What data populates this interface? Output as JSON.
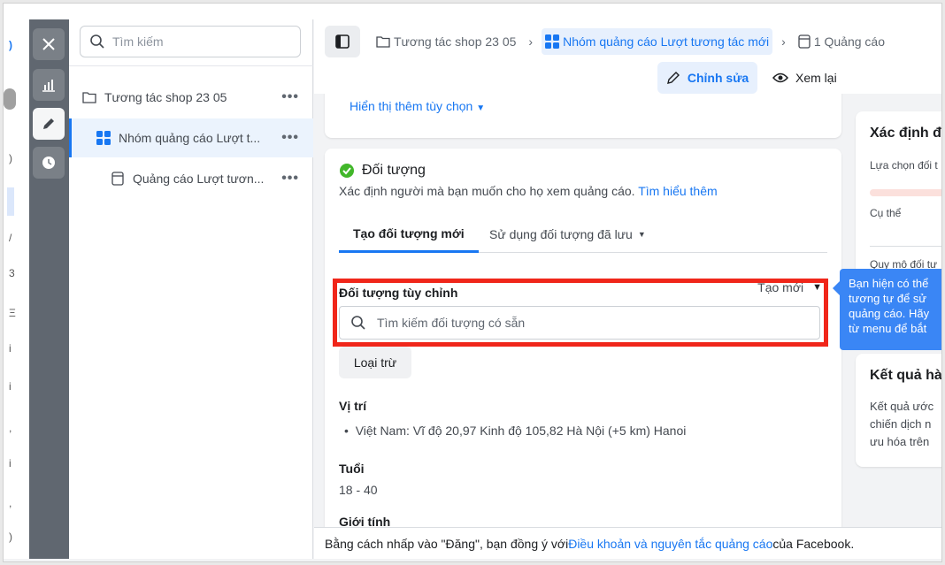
{
  "tree": {
    "search_placeholder": "Tìm kiếm",
    "items": [
      {
        "label": "Tương tác shop 23 05"
      },
      {
        "label": "Nhóm quảng cáo Lượt t..."
      },
      {
        "label": "Quảng cáo Lượt tươn..."
      }
    ],
    "dots": "•••"
  },
  "header": {
    "breadcrumbs": [
      {
        "label": "Tương tác shop 23 05"
      },
      {
        "label": "Nhóm quảng cáo Lượt tương tác mới"
      },
      {
        "label": "1 Quảng cáo"
      }
    ],
    "edit_label": "Chỉnh sửa",
    "review_label": "Xem lại"
  },
  "main": {
    "more_options": "Hiển thị thêm tùy chọn",
    "audience": {
      "title": "Đối tượng",
      "description": "Xác định người mà bạn muốn cho họ xem quảng cáo.",
      "learn_more": "Tìm hiểu thêm",
      "tabs": [
        {
          "label": "Tạo đối tượng mới"
        },
        {
          "label": "Sử dụng đối tượng đã lưu"
        }
      ],
      "custom_label": "Đối tượng tùy chỉnh",
      "create_new": "Tạo mới",
      "search_placeholder": "Tìm kiếm đối tượng có sẵn",
      "exclude_label": "Loại trừ",
      "location_label": "Vị trí",
      "location_value": "Việt Nam: Vĩ độ 20,97 Kinh độ 105,82 Hà Nội (+5 km) Hanoi",
      "age_label": "Tuổi",
      "age_value": "18 - 40",
      "gender_label": "Giới tính"
    }
  },
  "side": {
    "definition_title": "Xác định đ",
    "selection_label": "Lựa chọn đối t",
    "specific_label": "Cụ thể",
    "size_label": "Quy mô đối tư",
    "results_title": "Kết quả hà",
    "results_lines": [
      "Kết quả ước",
      "chiến dịch n",
      "ưu hóa trên"
    ],
    "tooltip_lines": [
      "Bạn hiện có thể",
      "tương tự để sử",
      "quảng cáo. Hãy",
      "từ menu để bắt"
    ]
  },
  "footer": {
    "prefix": "Bằng cách nhấp vào \"Đăng\", bạn đồng ý với ",
    "link": "Điều khoản và nguyên tắc quảng cáo",
    "suffix": " của Facebook."
  },
  "colors": {
    "accent": "#1877f2",
    "highlight": "#f0261a",
    "success": "#42b72a",
    "tooltip": "#3a86f5"
  }
}
